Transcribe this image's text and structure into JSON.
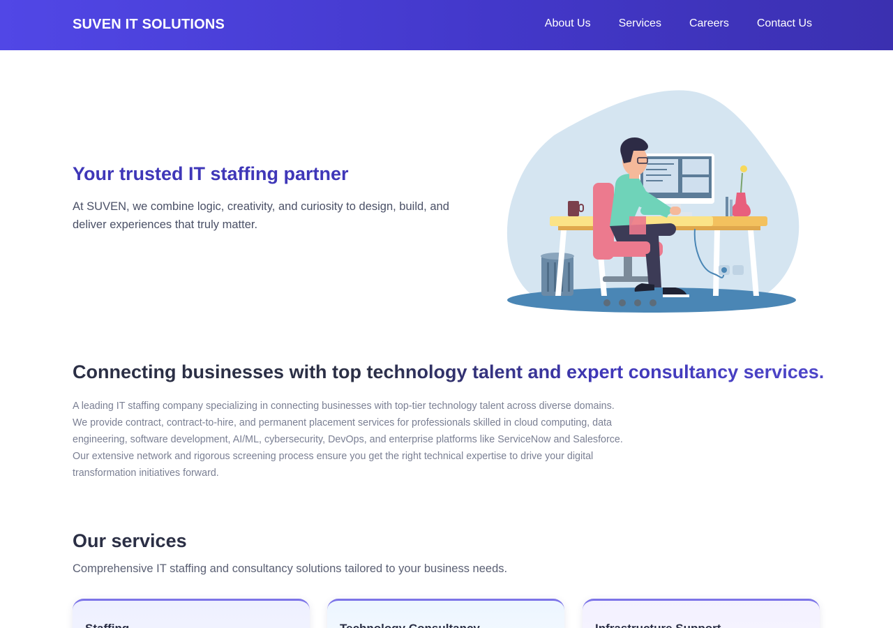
{
  "header": {
    "brand": "SUVEN IT SOLUTIONS",
    "nav": [
      "About Us",
      "Services",
      "Careers",
      "Contact Us"
    ]
  },
  "hero": {
    "title": "Your trusted IT staffing partner",
    "text": "At SUVEN, we combine logic, creativity, and curiosity to design, build, and deliver experiences that truly matter.",
    "illustration": "developer-at-desk-illustration"
  },
  "intro": {
    "tagline": "Connecting businesses with top technology talent and expert consultancy services.",
    "description": "A leading IT staffing company specializing in connecting businesses with top-tier technology talent across diverse domains. We provide contract, contract-to-hire, and permanent placement services for professionals skilled in cloud computing, data engineering, software development, AI/ML, cybersecurity, DevOps, and enterprise platforms like ServiceNow and Salesforce. Our extensive network and rigorous screening process ensure you get the right technical expertise to drive your digital transformation initiatives forward."
  },
  "services": {
    "title": "Our services",
    "subtitle": "Comprehensive IT staffing and consultancy solutions tailored to your business needs.",
    "cards": [
      {
        "title": "Staffing"
      },
      {
        "title": "Technology Consultancy"
      },
      {
        "title": "Infrastructure Support"
      }
    ]
  },
  "colors": {
    "nav_gradient_start": "#5147e6",
    "nav_gradient_end": "#3b30b0",
    "accent": "#3f37b8",
    "card_border": "#7c74e8"
  }
}
